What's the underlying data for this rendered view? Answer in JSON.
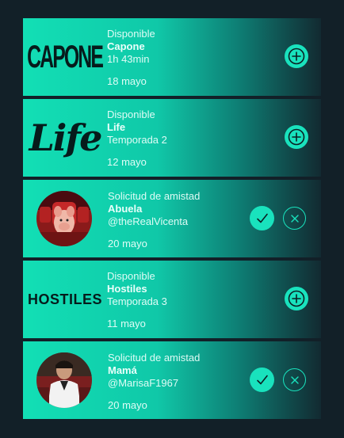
{
  "notifications": [
    {
      "type": "available",
      "kind": "Disponible",
      "name": "Capone",
      "sub": "1h 43min",
      "date": "18 mayo",
      "logo": "CAPONE"
    },
    {
      "type": "available",
      "kind": "Disponible",
      "name": "Life",
      "sub": "Temporada 2",
      "date": "12 mayo",
      "logo": "Life"
    },
    {
      "type": "friend",
      "kind": "Solicitud de amistad",
      "name": "Abuela",
      "sub": "@theRealVicenta",
      "date": "20 mayo"
    },
    {
      "type": "available",
      "kind": "Disponible",
      "name": "Hostiles",
      "sub": "Temporada 3",
      "date": "11 mayo",
      "logo": "HOSTILES"
    },
    {
      "type": "friend",
      "kind": "Solicitud de amistad",
      "name": "Mamá",
      "sub": "@MarisaF1967",
      "date": "20 mayo"
    }
  ],
  "icons": {
    "add": "plus-circle-icon",
    "accept": "check-icon",
    "reject": "x-icon"
  },
  "colors": {
    "background": "#122028",
    "accent": "#19e2bd",
    "card_start": "#12dfb5",
    "card_end": "#122a31"
  }
}
